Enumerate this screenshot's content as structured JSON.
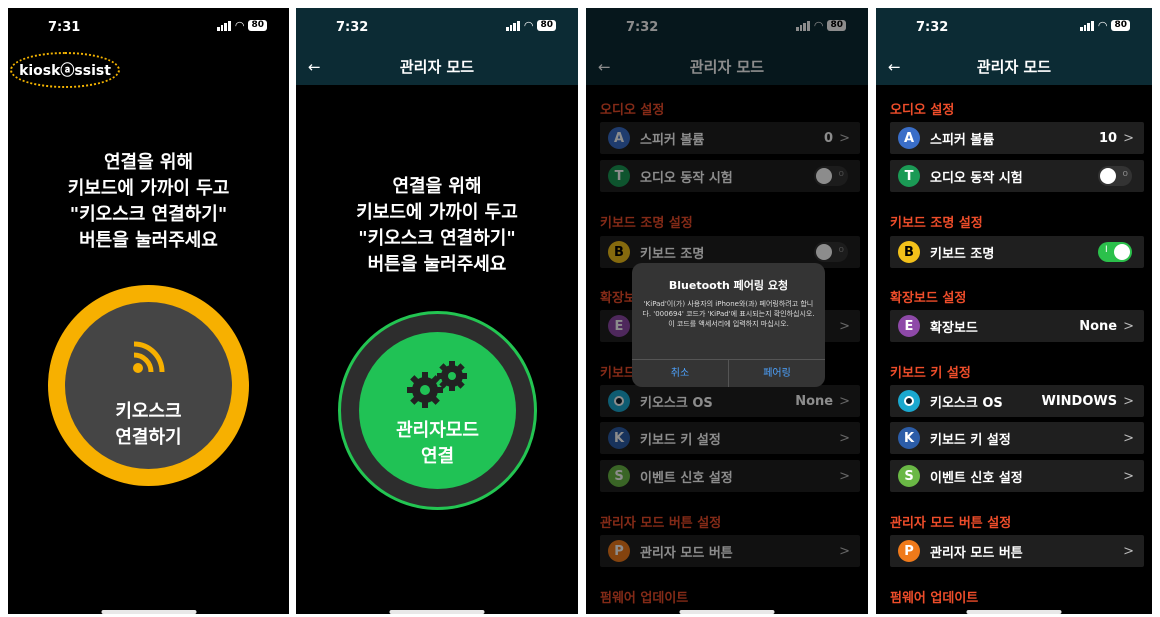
{
  "colors": {
    "accent_yellow": "#f7b000",
    "accent_green": "#20c255",
    "section_red": "#ee4d2a",
    "navbar": "#0c2b34"
  },
  "screen1": {
    "time": "7:31",
    "battery": "80",
    "logo": "kioskⓐssist",
    "instructions": [
      "연결을 위해",
      "키보드에 가까이 두고",
      "\"키오스크 연결하기\"",
      "버튼을 눌러주세요"
    ],
    "button_lines": [
      "키오스크",
      "연결하기"
    ]
  },
  "screen2": {
    "time": "7:32",
    "battery": "80",
    "title": "관리자 모드",
    "back": "←",
    "instructions": [
      "연결을 위해",
      "키보드에 가까이 두고",
      "\"키오스크 연결하기\"",
      "버튼을 눌러주세요"
    ],
    "button_lines": [
      "관리자모드",
      "연결"
    ]
  },
  "screen3": {
    "time": "7:32",
    "battery": "80",
    "title": "관리자 모드",
    "back": "←",
    "sections": [
      "오디오 설정",
      "키보드 조명 설정",
      "확장보",
      "키보드",
      "관리자 모드 버튼 설정",
      "펌웨어 업데이트"
    ],
    "rows": [
      {
        "icon": "A",
        "label": "스피커 볼륨",
        "value": "0",
        "chev": ">"
      },
      {
        "icon": "T",
        "label": "오디오 동작 시험",
        "toggle": "off"
      },
      {
        "icon": "B",
        "label": "키보드 조명",
        "toggle": "off"
      },
      {
        "icon": "E",
        "label": "",
        "chev": ">"
      },
      {
        "icon": "O",
        "label": "키오스크 OS",
        "value": "None",
        "chev": ">"
      },
      {
        "icon": "K",
        "label": "키보드 키 설정",
        "chev": ">"
      },
      {
        "icon": "S",
        "label": "이벤트 신호 설정",
        "chev": ">"
      },
      {
        "icon": "P",
        "label": "관리자 모드 버튼",
        "chev": ">"
      }
    ],
    "alert": {
      "title": "Bluetooth 페어링 요청",
      "body": "'KiPad'이(가) 사용자의 iPhone와(과) 페어링하려고 합니다. '000694' 코드가 'KiPad'에 표시되는지 확인하십시오. 이 코드를 액세서리에 입력하지 마십시오.",
      "cancel": "취소",
      "confirm": "페어링"
    }
  },
  "screen4": {
    "time": "7:32",
    "battery": "80",
    "title": "관리자 모드",
    "back": "←",
    "sections": [
      "오디오 설정",
      "키보드 조명 설정",
      "확장보드 설정",
      "키보드 키 설정",
      "관리자 모드 버튼 설정",
      "펌웨어 업데이트"
    ],
    "rows": [
      {
        "icon": "A",
        "label": "스피커 볼륨",
        "value": "10",
        "chev": ">"
      },
      {
        "icon": "T",
        "label": "오디오 동작 시험",
        "toggle": "off"
      },
      {
        "icon": "B",
        "label": "키보드 조명",
        "toggle": "on"
      },
      {
        "icon": "E",
        "label": "확장보드",
        "value": "None",
        "chev": ">"
      },
      {
        "icon": "O",
        "label": "키오스크 OS",
        "value": "WINDOWS",
        "chev": ">"
      },
      {
        "icon": "K",
        "label": "키보드 키 설정",
        "chev": ">"
      },
      {
        "icon": "S",
        "label": "이벤트 신호 설정",
        "chev": ">"
      },
      {
        "icon": "P",
        "label": "관리자 모드 버튼",
        "chev": ">"
      }
    ]
  }
}
